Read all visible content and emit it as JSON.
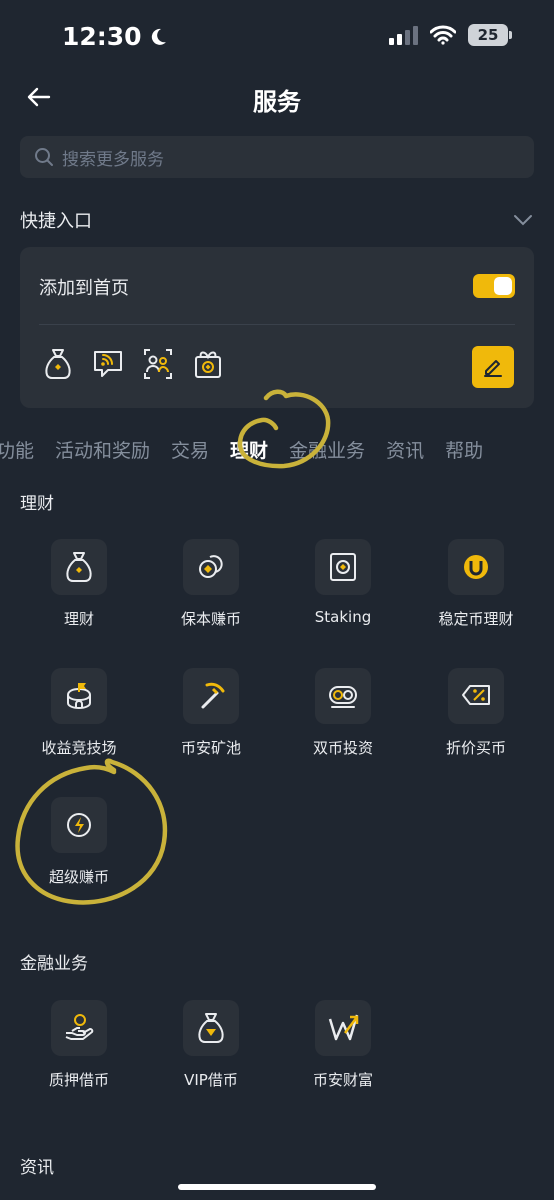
{
  "status": {
    "time": "12:30",
    "battery": "25"
  },
  "header": {
    "title": "服务"
  },
  "search": {
    "placeholder": "搜索更多服务"
  },
  "quick": {
    "title": "快捷入口",
    "add_to_home": "添加到首页",
    "toggle_on": true,
    "icons": [
      "money-bag-icon",
      "broadcast-chat-icon",
      "referral-icon",
      "gift-icon"
    ]
  },
  "tabs": [
    "功能",
    "活动和奖励",
    "交易",
    "理财",
    "金融业务",
    "资讯",
    "帮助"
  ],
  "tabs_visible_first": "功能",
  "active_tab": "理财",
  "sections": {
    "licai": {
      "title": "理财",
      "items": [
        {
          "label": "理财",
          "icon": "money-bag-icon"
        },
        {
          "label": "保本赚币",
          "icon": "coins-icon"
        },
        {
          "label": "Staking",
          "icon": "safe-icon"
        },
        {
          "label": "稳定币理财",
          "icon": "stablecoin-icon"
        },
        {
          "label": "收益竞技场",
          "icon": "arena-icon"
        },
        {
          "label": "币安矿池",
          "icon": "pickaxe-icon"
        },
        {
          "label": "双币投资",
          "icon": "dual-coin-icon"
        },
        {
          "label": "折价买币",
          "icon": "discount-tag-icon"
        },
        {
          "label": "超级赚币",
          "icon": "lightning-icon"
        }
      ]
    },
    "finance": {
      "title": "金融业务",
      "items": [
        {
          "label": "质押借币",
          "icon": "hand-coin-icon"
        },
        {
          "label": "VIP借币",
          "icon": "vip-diamond-bag-icon"
        },
        {
          "label": "币安财富",
          "icon": "wealth-w-icon"
        }
      ]
    },
    "news": {
      "title": "资讯"
    }
  },
  "colors": {
    "accent": "#f0b90b",
    "background": "#1f2630",
    "card": "#2b3139",
    "annotation": "#c9b23a"
  }
}
